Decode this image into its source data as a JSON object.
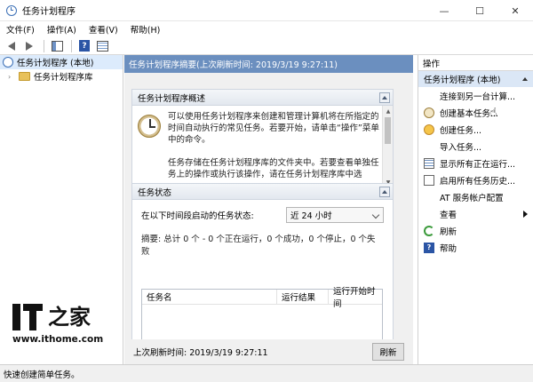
{
  "window": {
    "title": "任务计划程序",
    "minimize": "—",
    "maximize": "☐",
    "close": "✕"
  },
  "menu": [
    "文件(F)",
    "操作(A)",
    "查看(V)",
    "帮助(H)"
  ],
  "tree": {
    "root": "任务计划程序 (本地)",
    "child": "任务计划程序库"
  },
  "center": {
    "header": "任务计划程序摘要(上次刷新时间: 2019/3/19 9:27:11)",
    "overview": {
      "title": "任务计划程序概述",
      "para1": "可以使用任务计划程序来创建和管理计算机将在所指定的时间自动执行的常见任务。若要开始，请单击“操作”菜单中的命令。",
      "para2": "任务存储在任务计划程序库的文件夹中。若要查看单独任务上的操作或执行该操作，请在任务计划程序库中选"
    },
    "status": {
      "title": "任务状态",
      "range_label": "在以下时间段启动的任务状态:",
      "range_value": "近 24 小时",
      "summary": "摘要: 总计 0 个 - 0 个正在运行，0 个成功，0 个停止，0 个失败",
      "columns": [
        "任务名",
        "运行结果",
        "运行开始时间"
      ]
    },
    "footer": {
      "last_refresh": "上次刷新时间: 2019/3/19 9:27:11",
      "refresh_button": "刷新"
    }
  },
  "actions": {
    "header": "操作",
    "group": "任务计划程序 (本地)",
    "items": [
      {
        "label": "连接到另一台计算...",
        "icon": "blank"
      },
      {
        "label": "创建基本任务...",
        "icon": "clock-icon"
      },
      {
        "label": "创建任务...",
        "icon": "new-task-icon"
      },
      {
        "label": "导入任务...",
        "icon": "blank"
      },
      {
        "label": "显示所有正在运行...",
        "icon": "list-icon"
      },
      {
        "label": "启用所有任务历史...",
        "icon": "history-icon"
      },
      {
        "label": "AT 服务帐户配置",
        "icon": "blank"
      },
      {
        "label": "查看",
        "icon": "blank"
      },
      {
        "label": "刷新",
        "icon": "refresh-icon"
      },
      {
        "label": "帮助",
        "icon": "help-icon"
      }
    ]
  },
  "statusbar": "快速创建简单任务。",
  "watermark": {
    "brand_cn": "之家",
    "url": "www.ithome.com"
  }
}
